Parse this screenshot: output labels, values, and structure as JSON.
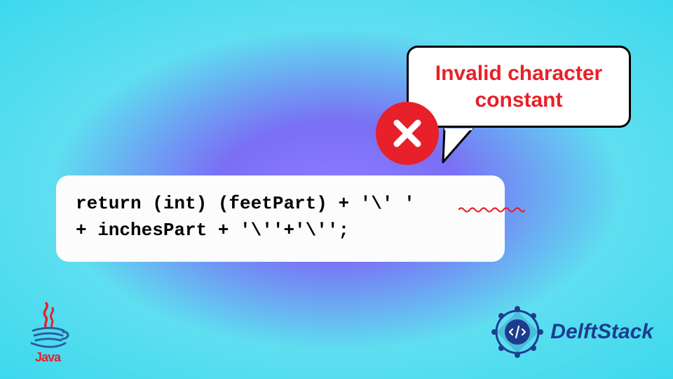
{
  "code": {
    "line1": "return (int) (feetPart) + '\\' '",
    "line2": "+ inchesPart + '\\''+'\\'';"
  },
  "error": {
    "message_line1": "Invalid character",
    "message_line2": "constant"
  },
  "logos": {
    "java": "Java",
    "delftstack": "DelftStack"
  },
  "colors": {
    "error_red": "#e8202a",
    "delft_blue": "#1c3d8f"
  }
}
